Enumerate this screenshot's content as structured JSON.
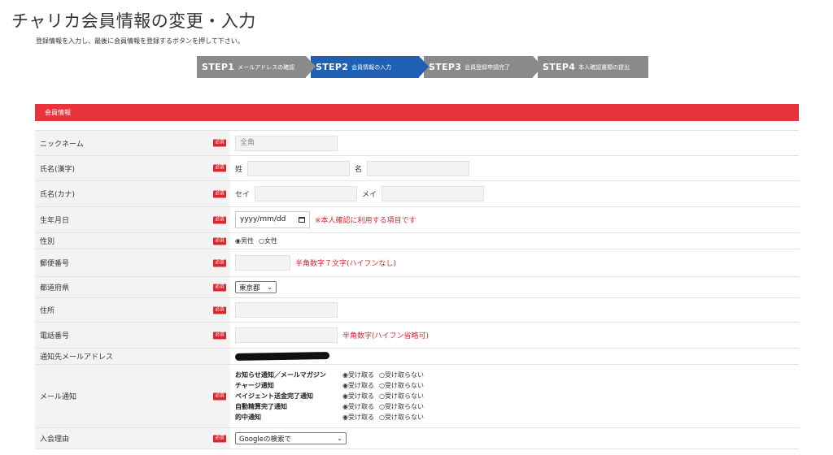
{
  "page": {
    "title": "チャリカ会員情報の変更・入力",
    "subtitle": "登録情報を入力し、最後に会員情報を登録するボタンを押して下さい。"
  },
  "steps": [
    {
      "num": "STEP1",
      "label": "メールアドレスの確認",
      "active": false
    },
    {
      "num": "STEP2",
      "label": "会員情報の入力",
      "active": true
    },
    {
      "num": "STEP3",
      "label": "会員登録申請完了",
      "active": false
    },
    {
      "num": "STEP4",
      "label": "本人確認書類の提出",
      "active": false
    }
  ],
  "section": {
    "title": "会員情報"
  },
  "required_badge": "必須",
  "fields": {
    "nickname": {
      "label": "ニックネーム",
      "placeholder": "全角"
    },
    "name_kanji": {
      "label": "氏名(漢字)",
      "sei": "姓",
      "mei": "名"
    },
    "name_kana": {
      "label": "氏名(カナ)",
      "sei": "セイ",
      "mei": "メイ"
    },
    "birthday": {
      "label": "生年月日",
      "value": "yyyy/mm/dd",
      "note": "※本人確認に利用する項目です"
    },
    "gender": {
      "label": "性別",
      "male": "◉男性",
      "female": "○女性"
    },
    "postal": {
      "label": "郵便番号",
      "note": "半角数字７文字(ハイフンなし)"
    },
    "prefecture": {
      "label": "都道府県",
      "selected": "東京都"
    },
    "address": {
      "label": "住所"
    },
    "phone": {
      "label": "電話番号",
      "note": "半角数字(ハイフン省略可)"
    },
    "email": {
      "label": "通知先メールアドレス"
    },
    "mail": {
      "label": "メール通知",
      "accept": "◉受け取る",
      "reject": "○受け取らない",
      "items": [
        "お知らせ通知／メールマガジン",
        "チャージ通知",
        "ペイジェント送金完了通知",
        "自動精算完了通知",
        "的中通知"
      ]
    },
    "reason": {
      "label": "入会理由",
      "selected": "Googleの検索で"
    }
  },
  "colors": {
    "accent_red": "#e8333d",
    "step_active": "#1f5fb4",
    "step_inactive": "#8a8a8a"
  }
}
